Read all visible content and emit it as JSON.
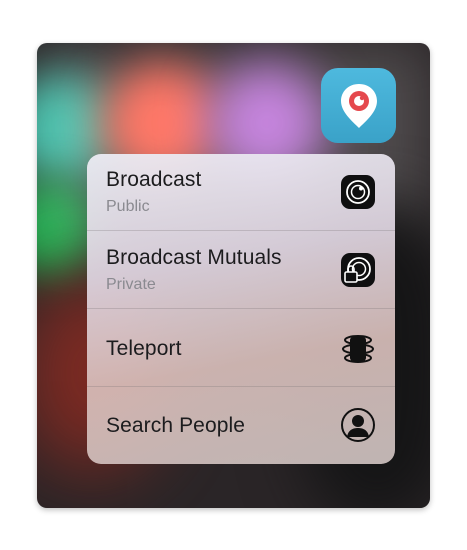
{
  "app": {
    "icon": "periscope-app-icon",
    "icon_color": "#3ea8d0"
  },
  "quick_actions": [
    {
      "title": "Broadcast",
      "subtitle": "Public",
      "icon": "broadcast-camera-icon"
    },
    {
      "title": "Broadcast Mutuals",
      "subtitle": "Private",
      "icon": "broadcast-private-lock-icon"
    },
    {
      "title": "Teleport",
      "subtitle": "",
      "icon": "teleport-icon"
    },
    {
      "title": "Search People",
      "subtitle": "",
      "icon": "person-icon"
    }
  ],
  "colors": {
    "menu_text": "#1c1c1e",
    "menu_subtext": "#8a8a90"
  }
}
